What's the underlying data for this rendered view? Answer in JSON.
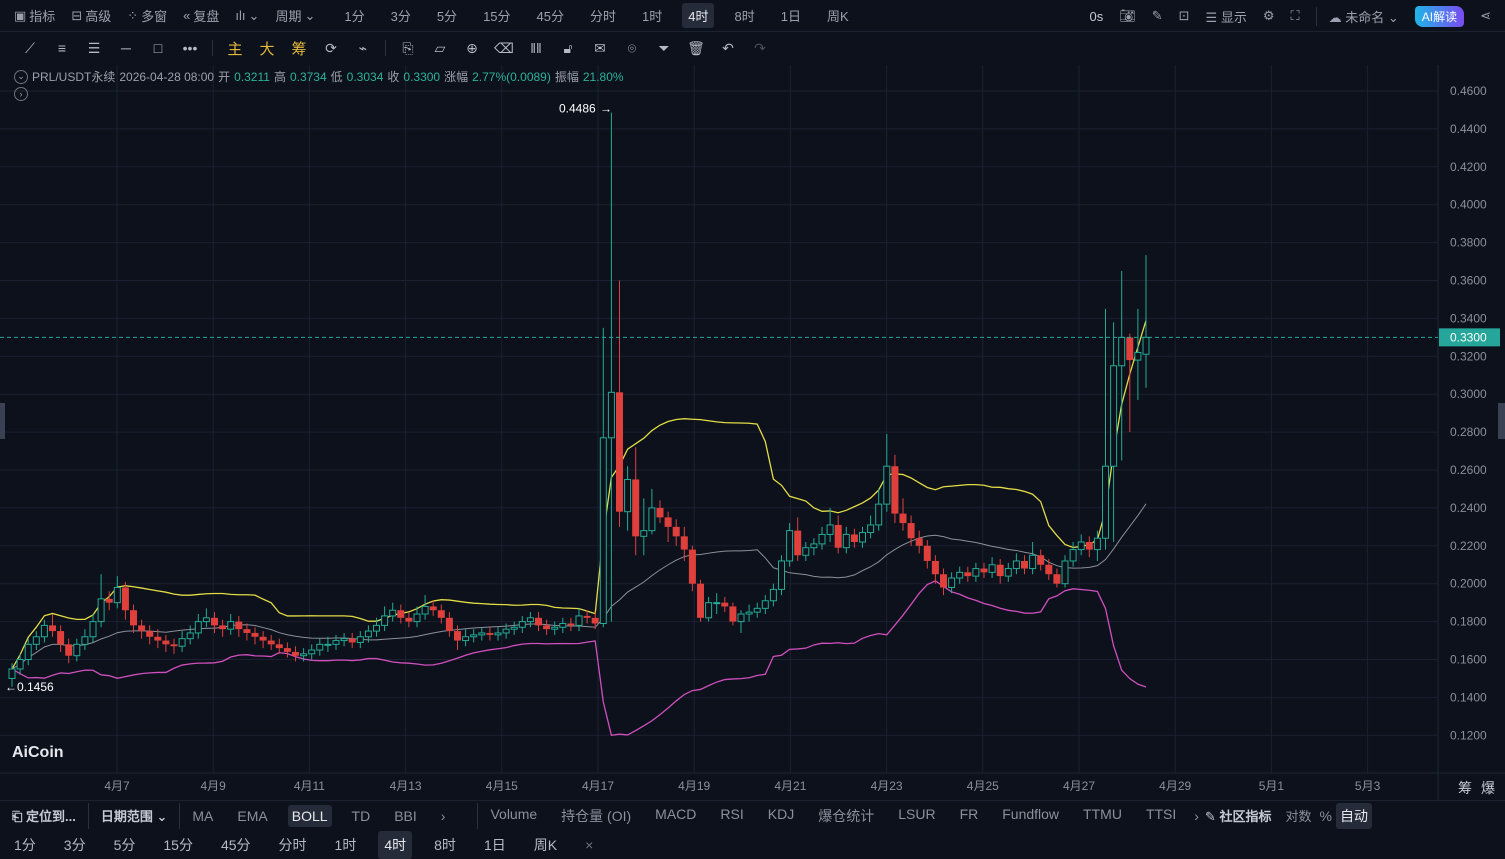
{
  "topbar": {
    "items": [
      "指标",
      "高级",
      "多窗",
      "复盘"
    ],
    "period_label": "周期",
    "periods": [
      "1分",
      "3分",
      "5分",
      "15分",
      "45分",
      "分时",
      "1时",
      "4时",
      "8时",
      "1日",
      "周K"
    ],
    "active_period": "4时",
    "countdown": "0s",
    "display": "显示",
    "layout_name": "未命名",
    "ai_button": "AI解读"
  },
  "drawing_tools": {
    "main": "主",
    "big": "大",
    "chips": "筹"
  },
  "info": {
    "symbol": "PRL/USDT永续",
    "time": "2026-04-28 08:00",
    "open_label": "开",
    "open": "0.3211",
    "high_label": "高",
    "high": "0.3734",
    "low_label": "低",
    "low": "0.3034",
    "close_label": "收",
    "close": "0.3300",
    "change_label": "涨幅",
    "change": "2.77%(0.0089)",
    "amp_label": "振幅",
    "amp": "21.80%"
  },
  "chart_data": {
    "type": "candlestick",
    "symbol": "PRL/USDT",
    "interval": "4h",
    "ylim": [
      0.11,
      0.47
    ],
    "yticks": [
      "0.4600",
      "0.4400",
      "0.4200",
      "0.4000",
      "0.3800",
      "0.3600",
      "0.3400",
      "0.3200",
      "0.3000",
      "0.2800",
      "0.2600",
      "0.2400",
      "0.2200",
      "0.2000",
      "0.1800",
      "0.1600",
      "0.1400",
      "0.1200"
    ],
    "xticks": [
      "4月7",
      "4月9",
      "4月11",
      "4月13",
      "4月15",
      "4月17",
      "4月19",
      "4月21",
      "4月23",
      "4月25",
      "4月27",
      "4月29",
      "5月1",
      "5月3"
    ],
    "current_price": "0.3300",
    "max_label": "0.4486",
    "min_label": "0.1456",
    "indicator": "BOLL(20,2)",
    "candles": [
      [
        0.15,
        0.158,
        0.1456,
        0.155
      ],
      [
        0.155,
        0.163,
        0.152,
        0.16
      ],
      [
        0.16,
        0.171,
        0.157,
        0.168
      ],
      [
        0.168,
        0.175,
        0.165,
        0.172
      ],
      [
        0.172,
        0.181,
        0.169,
        0.178
      ],
      [
        0.178,
        0.184,
        0.172,
        0.175
      ],
      [
        0.175,
        0.178,
        0.164,
        0.168
      ],
      [
        0.168,
        0.171,
        0.158,
        0.162
      ],
      [
        0.162,
        0.171,
        0.159,
        0.168
      ],
      [
        0.168,
        0.176,
        0.165,
        0.172
      ],
      [
        0.172,
        0.184,
        0.169,
        0.18
      ],
      [
        0.18,
        0.205,
        0.177,
        0.192
      ],
      [
        0.192,
        0.196,
        0.186,
        0.19
      ],
      [
        0.19,
        0.204,
        0.187,
        0.198
      ],
      [
        0.198,
        0.201,
        0.181,
        0.186
      ],
      [
        0.186,
        0.189,
        0.174,
        0.178
      ],
      [
        0.178,
        0.181,
        0.171,
        0.175
      ],
      [
        0.175,
        0.178,
        0.168,
        0.172
      ],
      [
        0.172,
        0.176,
        0.166,
        0.17
      ],
      [
        0.17,
        0.173,
        0.164,
        0.168
      ],
      [
        0.168,
        0.171,
        0.163,
        0.167
      ],
      [
        0.167,
        0.175,
        0.164,
        0.171
      ],
      [
        0.171,
        0.178,
        0.168,
        0.174
      ],
      [
        0.174,
        0.184,
        0.171,
        0.18
      ],
      [
        0.18,
        0.187,
        0.177,
        0.182
      ],
      [
        0.182,
        0.185,
        0.174,
        0.178
      ],
      [
        0.178,
        0.181,
        0.172,
        0.176
      ],
      [
        0.176,
        0.184,
        0.173,
        0.18
      ],
      [
        0.18,
        0.183,
        0.172,
        0.176
      ],
      [
        0.176,
        0.179,
        0.17,
        0.174
      ],
      [
        0.174,
        0.177,
        0.168,
        0.172
      ],
      [
        0.172,
        0.175,
        0.166,
        0.17
      ],
      [
        0.17,
        0.173,
        0.165,
        0.168
      ],
      [
        0.168,
        0.171,
        0.163,
        0.166
      ],
      [
        0.166,
        0.169,
        0.161,
        0.164
      ],
      [
        0.164,
        0.167,
        0.159,
        0.162
      ],
      [
        0.162,
        0.166,
        0.159,
        0.163
      ],
      [
        0.163,
        0.168,
        0.16,
        0.165
      ],
      [
        0.165,
        0.171,
        0.162,
        0.168
      ],
      [
        0.168,
        0.172,
        0.164,
        0.168
      ],
      [
        0.168,
        0.173,
        0.165,
        0.17
      ],
      [
        0.17,
        0.174,
        0.167,
        0.171
      ],
      [
        0.171,
        0.174,
        0.166,
        0.169
      ],
      [
        0.169,
        0.175,
        0.166,
        0.172
      ],
      [
        0.172,
        0.178,
        0.169,
        0.175
      ],
      [
        0.175,
        0.182,
        0.172,
        0.178
      ],
      [
        0.178,
        0.188,
        0.175,
        0.183
      ],
      [
        0.183,
        0.19,
        0.18,
        0.186
      ],
      [
        0.186,
        0.189,
        0.179,
        0.182
      ],
      [
        0.182,
        0.185,
        0.177,
        0.18
      ],
      [
        0.18,
        0.188,
        0.177,
        0.184
      ],
      [
        0.184,
        0.194,
        0.181,
        0.188
      ],
      [
        0.188,
        0.191,
        0.183,
        0.186
      ],
      [
        0.186,
        0.189,
        0.179,
        0.182
      ],
      [
        0.182,
        0.185,
        0.172,
        0.175
      ],
      [
        0.175,
        0.178,
        0.165,
        0.17
      ],
      [
        0.17,
        0.176,
        0.167,
        0.172
      ],
      [
        0.172,
        0.176,
        0.169,
        0.173
      ],
      [
        0.173,
        0.177,
        0.17,
        0.174
      ],
      [
        0.174,
        0.177,
        0.17,
        0.173
      ],
      [
        0.173,
        0.177,
        0.17,
        0.174
      ],
      [
        0.174,
        0.179,
        0.171,
        0.176
      ],
      [
        0.176,
        0.18,
        0.173,
        0.177
      ],
      [
        0.177,
        0.183,
        0.174,
        0.18
      ],
      [
        0.18,
        0.185,
        0.177,
        0.182
      ],
      [
        0.182,
        0.185,
        0.175,
        0.178
      ],
      [
        0.178,
        0.181,
        0.173,
        0.176
      ],
      [
        0.176,
        0.18,
        0.173,
        0.177
      ],
      [
        0.177,
        0.182,
        0.174,
        0.179
      ],
      [
        0.179,
        0.182,
        0.175,
        0.178
      ],
      [
        0.178,
        0.187,
        0.175,
        0.183
      ],
      [
        0.183,
        0.186,
        0.179,
        0.182
      ],
      [
        0.182,
        0.185,
        0.176,
        0.179
      ],
      [
        0.179,
        0.335,
        0.177,
        0.277
      ],
      [
        0.277,
        0.4486,
        0.18,
        0.301
      ],
      [
        0.301,
        0.36,
        0.23,
        0.238
      ],
      [
        0.238,
        0.262,
        0.228,
        0.255
      ],
      [
        0.255,
        0.272,
        0.215,
        0.225
      ],
      [
        0.225,
        0.245,
        0.215,
        0.228
      ],
      [
        0.228,
        0.25,
        0.226,
        0.24
      ],
      [
        0.24,
        0.244,
        0.232,
        0.235
      ],
      [
        0.235,
        0.238,
        0.222,
        0.23
      ],
      [
        0.23,
        0.234,
        0.22,
        0.225
      ],
      [
        0.225,
        0.23,
        0.212,
        0.218
      ],
      [
        0.218,
        0.22,
        0.196,
        0.2
      ],
      [
        0.2,
        0.202,
        0.18,
        0.182
      ],
      [
        0.182,
        0.193,
        0.18,
        0.19
      ],
      [
        0.19,
        0.195,
        0.184,
        0.19
      ],
      [
        0.19,
        0.193,
        0.185,
        0.188
      ],
      [
        0.188,
        0.19,
        0.178,
        0.18
      ],
      [
        0.18,
        0.186,
        0.174,
        0.184
      ],
      [
        0.184,
        0.189,
        0.18,
        0.185
      ],
      [
        0.185,
        0.19,
        0.182,
        0.187
      ],
      [
        0.187,
        0.194,
        0.184,
        0.191
      ],
      [
        0.191,
        0.2,
        0.188,
        0.197
      ],
      [
        0.197,
        0.215,
        0.194,
        0.212
      ],
      [
        0.212,
        0.232,
        0.209,
        0.228
      ],
      [
        0.228,
        0.235,
        0.212,
        0.215
      ],
      [
        0.215,
        0.222,
        0.212,
        0.219
      ],
      [
        0.219,
        0.224,
        0.215,
        0.221
      ],
      [
        0.221,
        0.23,
        0.218,
        0.226
      ],
      [
        0.226,
        0.24,
        0.222,
        0.231
      ],
      [
        0.231,
        0.236,
        0.216,
        0.219
      ],
      [
        0.219,
        0.23,
        0.216,
        0.226
      ],
      [
        0.226,
        0.229,
        0.219,
        0.222
      ],
      [
        0.222,
        0.23,
        0.219,
        0.227
      ],
      [
        0.227,
        0.236,
        0.224,
        0.231
      ],
      [
        0.231,
        0.25,
        0.228,
        0.242
      ],
      [
        0.242,
        0.279,
        0.238,
        0.262
      ],
      [
        0.262,
        0.268,
        0.232,
        0.237
      ],
      [
        0.237,
        0.245,
        0.228,
        0.232
      ],
      [
        0.232,
        0.236,
        0.22,
        0.224
      ],
      [
        0.224,
        0.228,
        0.216,
        0.22
      ],
      [
        0.22,
        0.223,
        0.208,
        0.212
      ],
      [
        0.212,
        0.215,
        0.2,
        0.205
      ],
      [
        0.205,
        0.208,
        0.194,
        0.198
      ],
      [
        0.198,
        0.206,
        0.195,
        0.203
      ],
      [
        0.203,
        0.209,
        0.2,
        0.206
      ],
      [
        0.206,
        0.209,
        0.201,
        0.204
      ],
      [
        0.204,
        0.211,
        0.201,
        0.208
      ],
      [
        0.208,
        0.211,
        0.203,
        0.206
      ],
      [
        0.206,
        0.214,
        0.203,
        0.21
      ],
      [
        0.21,
        0.213,
        0.2,
        0.204
      ],
      [
        0.204,
        0.211,
        0.201,
        0.208
      ],
      [
        0.208,
        0.216,
        0.205,
        0.212
      ],
      [
        0.212,
        0.215,
        0.205,
        0.208
      ],
      [
        0.208,
        0.222,
        0.205,
        0.215
      ],
      [
        0.215,
        0.218,
        0.207,
        0.21
      ],
      [
        0.21,
        0.213,
        0.202,
        0.205
      ],
      [
        0.205,
        0.208,
        0.198,
        0.2
      ],
      [
        0.2,
        0.215,
        0.198,
        0.212
      ],
      [
        0.212,
        0.222,
        0.209,
        0.218
      ],
      [
        0.218,
        0.226,
        0.215,
        0.222
      ],
      [
        0.222,
        0.225,
        0.214,
        0.218
      ],
      [
        0.218,
        0.228,
        0.212,
        0.224
      ],
      [
        0.224,
        0.345,
        0.218,
        0.262
      ],
      [
        0.262,
        0.338,
        0.222,
        0.315
      ],
      [
        0.315,
        0.365,
        0.265,
        0.33
      ],
      [
        0.33,
        0.332,
        0.28,
        0.318
      ],
      [
        0.318,
        0.345,
        0.297,
        0.322
      ],
      [
        0.3211,
        0.3734,
        0.3034,
        0.33
      ]
    ],
    "colors": {
      "up": "#22ab94",
      "down": "#e0403c",
      "upper": "#e3dc45",
      "mid": "#8c909a",
      "lower": "#d04fbe",
      "price": "#26a69a"
    }
  },
  "axis_extra": {
    "chips": "筹",
    "liq": "爆"
  },
  "bottom1": {
    "locate": "定位到...",
    "date_range": "日期范围",
    "main_indicators": [
      "MA",
      "EMA",
      "BOLL",
      "TD",
      "BBI"
    ],
    "active": "BOLL",
    "sub_indicators": [
      "Volume",
      "持仓量 (OI)",
      "MACD",
      "RSI",
      "KDJ",
      "爆仓统计",
      "LSUR",
      "FR",
      "Fundflow",
      "TTMU",
      "TTSI"
    ],
    "community": "社区指标",
    "log": "对数",
    "percent": "%",
    "auto": "自动"
  },
  "bottom2": {
    "periods": [
      "1分",
      "3分",
      "5分",
      "15分",
      "45分",
      "分时",
      "1时",
      "4时",
      "8时",
      "1日",
      "周K"
    ],
    "active": "4时",
    "close": "×"
  },
  "logo": "AiCoin"
}
